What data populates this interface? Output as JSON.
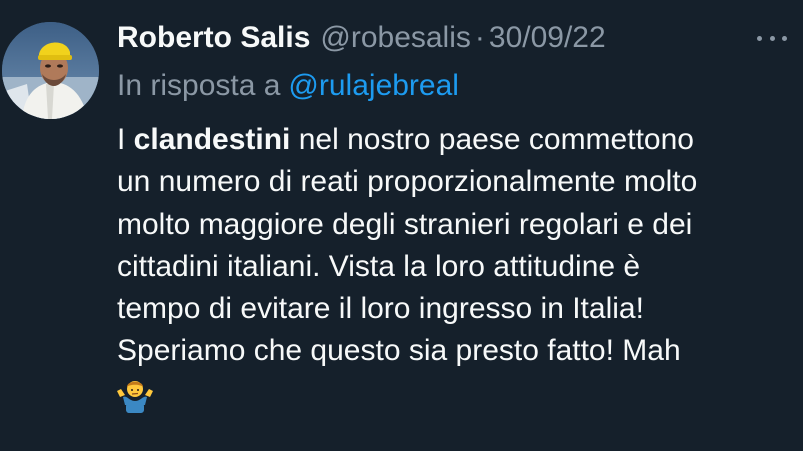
{
  "author": {
    "name": "Roberto Salis",
    "handle": "@robesalis",
    "separator": "·",
    "date": "30/09/22"
  },
  "reply_to": {
    "prefix": "In risposta a",
    "mention": "@rulajebreal"
  },
  "tweet": {
    "line1_start": "I ",
    "line1_bold": "clandestini",
    "line1_end": " nel nostro paese commettono",
    "line2": "un numero di reati proporzionalmente molto",
    "line3": "molto maggiore degli stranieri regolari e dei",
    "line4": "cittadini italiani. Vista la loro attitudine è",
    "line5": "tempo di evitare il loro ingresso in Italia!",
    "line6": "Speriamo che questo sia presto fatto! Mah",
    "emoji": "person-shrugging-icon"
  },
  "icons": {
    "more": "more-options-icon",
    "avatar": "avatar"
  },
  "colors": {
    "background": "#15202b",
    "text": "#f7f9f9",
    "secondary_text": "#8b98a5",
    "link": "#1d9bf0"
  }
}
